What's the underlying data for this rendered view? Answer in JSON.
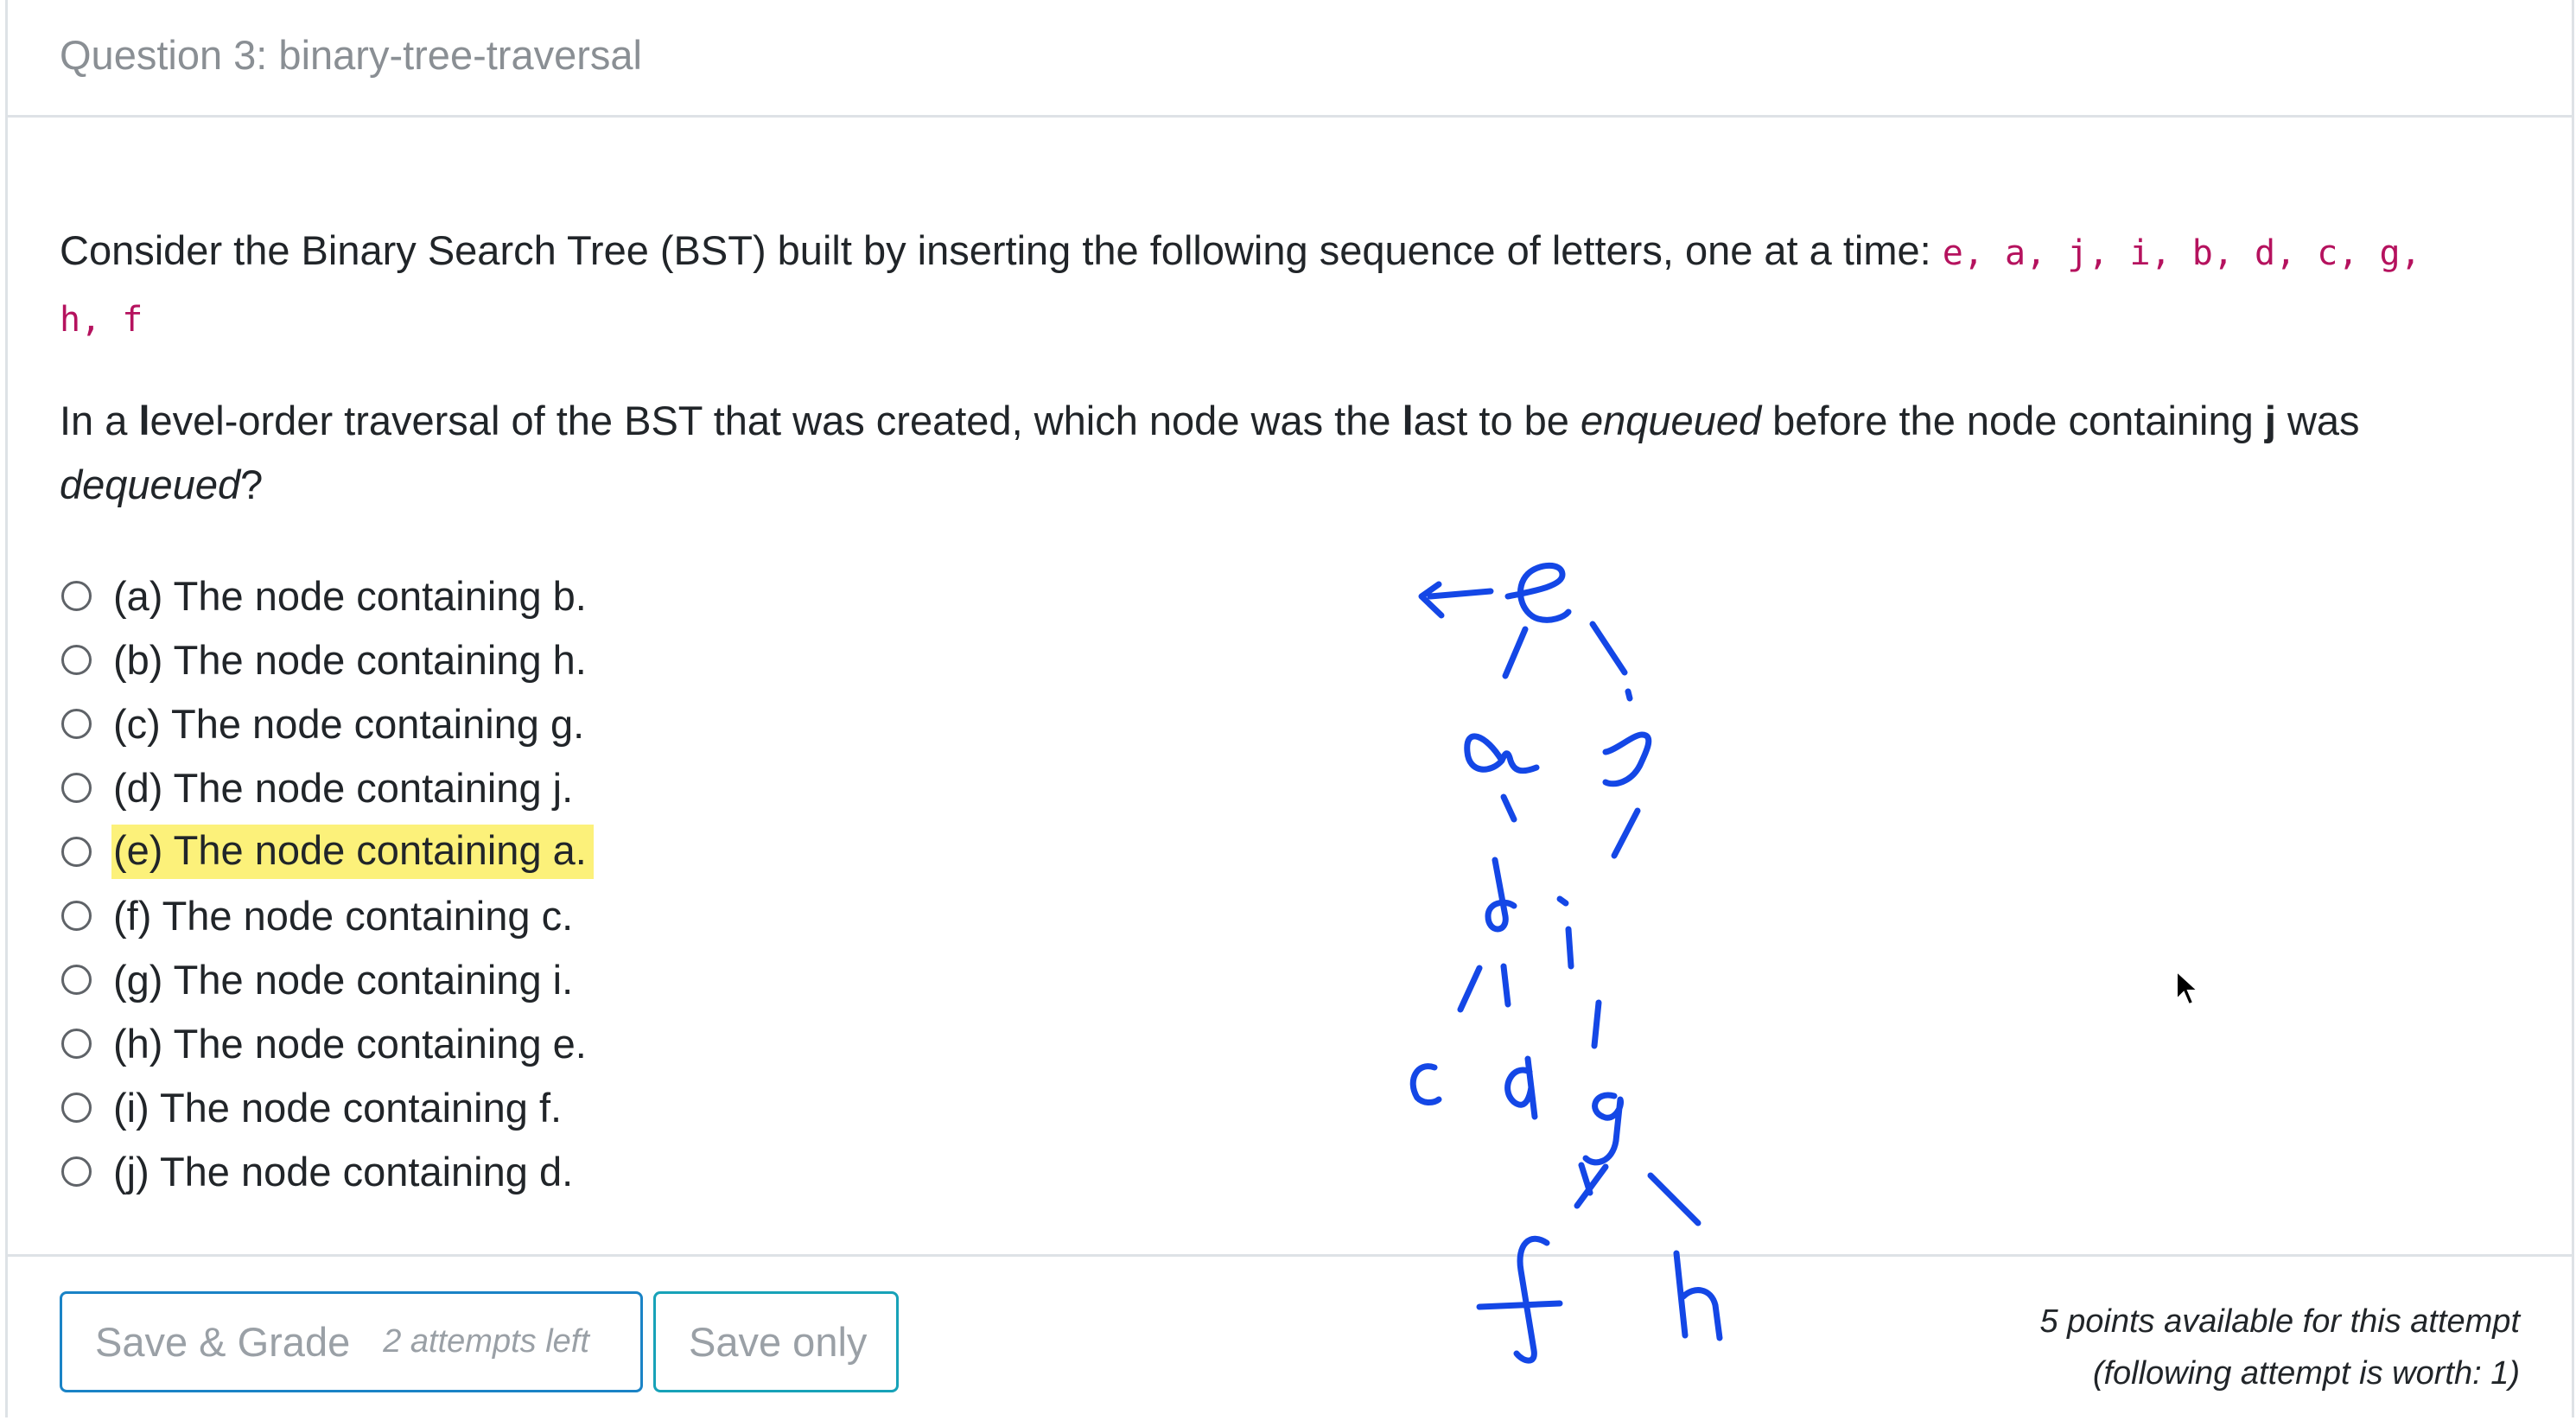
{
  "question": {
    "title": "Question 3: binary-tree-traversal",
    "paragraph1_text": "Consider the Binary Search Tree (BST) built by inserting the following sequence of letters, one at a time:",
    "sequence_line1": "e, a, j, i, b, d, c, g,",
    "sequence_line2": "h, f",
    "p2_part1": "In a ",
    "p2_bold1": "l",
    "p2_part2": "evel-order traversal of the BST that was created, which node was the ",
    "p2_bold2": "l",
    "p2_part3": "ast to be ",
    "p2_em1": "enqueued",
    "p2_part4": " before the node containing ",
    "p2_bold3": "j",
    "p2_part5": " was ",
    "p2_em2": "dequeued",
    "p2_part6": "?"
  },
  "options": [
    {
      "label": "(a) The node containing b."
    },
    {
      "label": "(b) The node containing h."
    },
    {
      "label": "(c) The node containing g."
    },
    {
      "label": "(d) The node containing j."
    },
    {
      "label": "(e) The node containing a."
    },
    {
      "label": "(f) The node containing c."
    },
    {
      "label": "(g) The node containing i."
    },
    {
      "label": "(h) The node containing e."
    },
    {
      "label": "(i) The node containing f."
    },
    {
      "label": "(j) The node containing d."
    }
  ],
  "footer": {
    "grade_button": "Save & Grade",
    "attempts_left": "2 attempts left",
    "save_only_button": "Save only",
    "points_line1": "5 points available for this attempt",
    "points_line2": "(following attempt is worth: 1)"
  },
  "annotation": {
    "ink_color": "#1447e6",
    "highlight_color": "#fcf17a",
    "letters": [
      "e",
      "a",
      "j",
      "b",
      "i",
      "c",
      "d",
      "g",
      "f",
      "h"
    ]
  }
}
